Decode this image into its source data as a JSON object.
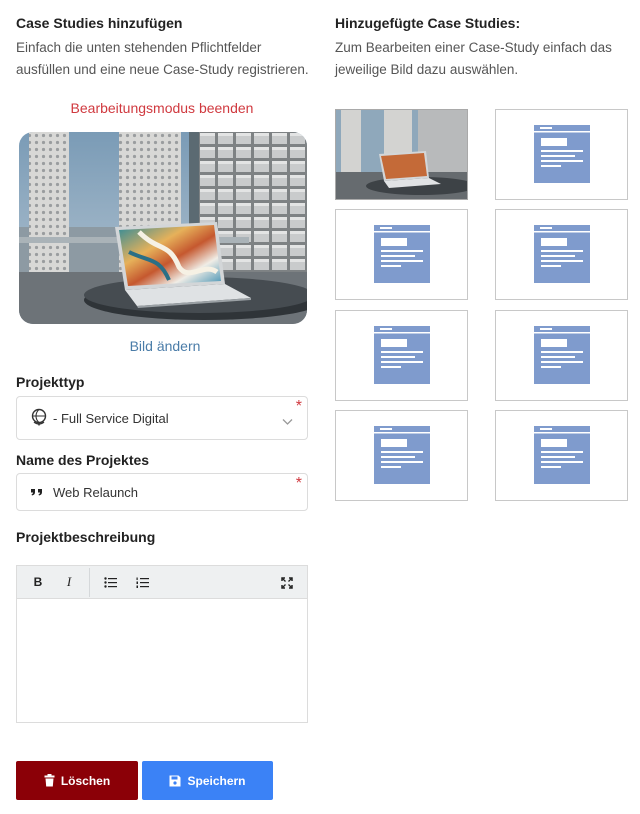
{
  "left": {
    "title": "Case Studies hinzufügen",
    "subtitle_line1": "Einfach die unten stehenden Pflichtfelder",
    "subtitle_line2": "ausfüllen und eine neue Case-Study registrieren.",
    "exit_edit_mode": "Bearbeitungsmodus beenden",
    "change_image": "Bild ändern",
    "project_type": {
      "label": "Projekttyp",
      "value": "- Full Service Digital",
      "icon": "globe-icon",
      "required_mark": "*"
    },
    "project_name": {
      "label": "Name des Projektes",
      "value": "Web Relaunch",
      "icon": "quote-icon",
      "required_mark": "*"
    },
    "description": {
      "label": "Projektbeschreibung",
      "toolbar": {
        "bold": "B",
        "italic": "I"
      },
      "content": ""
    },
    "buttons": {
      "delete": "Löschen",
      "save": "Speichern"
    }
  },
  "right": {
    "title": "Hinzugefügte Case Studies:",
    "subtitle_line1": "Zum Bearbeiten einer Case-Study einfach das",
    "subtitle_line2": "jeweilige Bild dazu auswählen.",
    "thumbnails": [
      "photo",
      "placeholder",
      "placeholder",
      "placeholder",
      "placeholder",
      "placeholder",
      "placeholder",
      "placeholder"
    ]
  },
  "colors": {
    "accent_red": "#d0393f",
    "link_blue": "#4a7ca8",
    "delete_button": "#8b0007",
    "save_button": "#3b82f6",
    "placeholder_fill": "#7f9bcd"
  }
}
